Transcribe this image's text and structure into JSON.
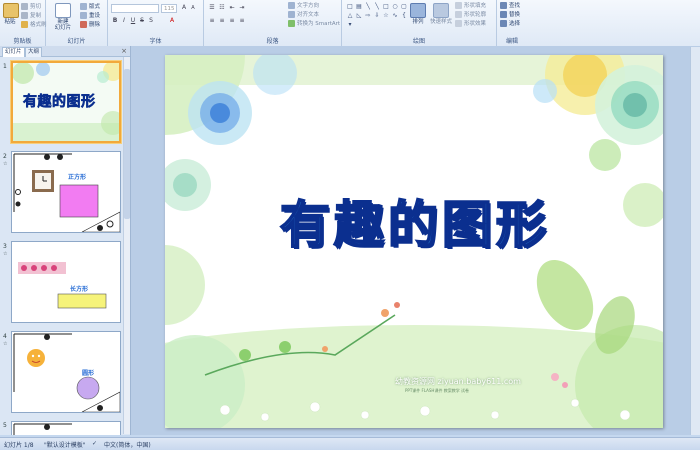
{
  "ribbon": {
    "clipboard": {
      "paste": "粘贴",
      "cut": "剪切",
      "copy": "复制",
      "format_painter": "格式刷",
      "label": "剪贴板"
    },
    "slides": {
      "new_slide": "新建\n幻灯片",
      "layout": "版式",
      "reset": "重设",
      "delete": "删除",
      "label": "幻灯片"
    },
    "font": {
      "font_value": "",
      "size_value": "115",
      "label": "字体"
    },
    "paragraph": {
      "text_direction": "文字方向",
      "align_text": "对齐文本",
      "smartart": "转换为 SmartArt",
      "label": "段落"
    },
    "drawing": {
      "arrange": "排列",
      "quick_styles": "快速样式",
      "shape_fill": "形状填充",
      "shape_outline": "形状轮廓",
      "shape_effects": "形状效果",
      "label": "绘图"
    },
    "editing": {
      "find": "查找",
      "replace": "替换",
      "select": "选择",
      "label": "编辑"
    }
  },
  "leftpane": {
    "tab_slides": "幻灯片",
    "tab_outline": "大纲",
    "close": "×",
    "thumbs": [
      {
        "num": "1",
        "title": "有趣的图形"
      },
      {
        "num": "2",
        "label": "正方形"
      },
      {
        "num": "3",
        "label": "长方形"
      },
      {
        "num": "4",
        "label": "圆形"
      },
      {
        "num": "5"
      }
    ]
  },
  "slide": {
    "title": "有趣的图形",
    "watermark": "幼教资源网 ziyuan.baby611.com",
    "watermark_sub": "PPT课件  FLASH课件  教案教学  试卷"
  },
  "status": {
    "slide_info": "幻灯片 1/8",
    "theme": "\"默认设计模板\"",
    "language": "中文(简体，中国)"
  },
  "colors": {
    "ribbon_bg": "#dfe9f6",
    "title_fill": "#2f8ee0",
    "title_outline": "#0b2f8f",
    "selected_border": "#f2a93b"
  }
}
